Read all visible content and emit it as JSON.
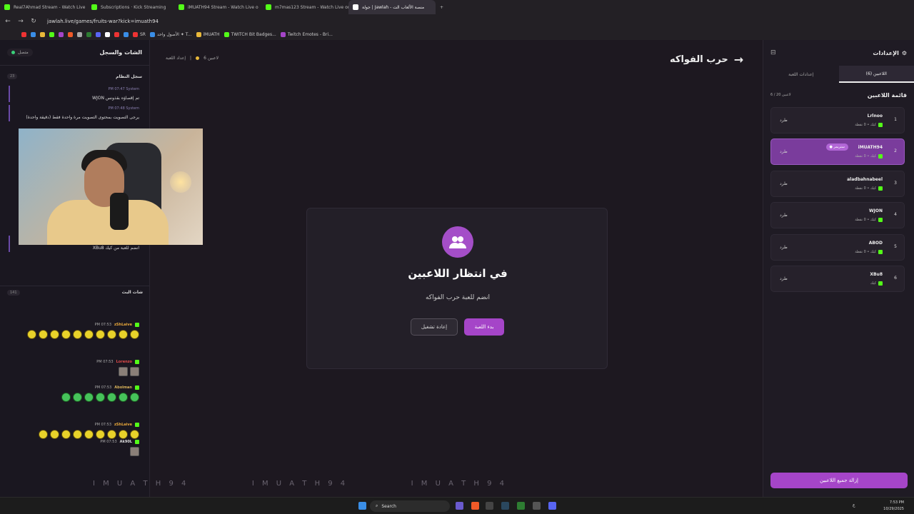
{
  "browser": {
    "tabs": [
      {
        "label": "Real7Ahmad Stream - Watch Live",
        "color": "#53fc18"
      },
      {
        "label": "Subscriptions · Kick Streaming",
        "color": "#53fc18"
      },
      {
        "label": "iMUATH94 Stream - Watch Live o",
        "color": "#53fc18"
      },
      {
        "label": "m7mas123 Stream - Watch Live on",
        "color": "#53fc18"
      },
      {
        "label": "جولة | Jawlah - منصة الألعاب الت",
        "color": "#ffffff",
        "active": true
      }
    ],
    "url": "jawlah.live/games/fruits-war?kick=imuath94",
    "bookmarks": [
      "SR",
      "الأصول واحد ✦ T...",
      "iMUATH",
      "TWITCH Bit Badges...",
      "Twitch Emotes - Bri..."
    ]
  },
  "left_panel": {
    "title": "الشات والسجل",
    "status": "متصل",
    "system_log": {
      "title": "سجل النظام",
      "count": "23",
      "messages": [
        {
          "time": "PM 07:47",
          "sender": "System",
          "text": "WJON تم إقصاؤه بقذونس"
        },
        {
          "time": "PM 07:48",
          "sender": "System",
          "text": "يرجى التصويت بمحتوى التصويت مرة واحدة فقط (دقيقة واحدة)"
        },
        {
          "time": "PM 07:52",
          "sender": "System",
          "text": "XBu8 انضم للعبة من كيك"
        }
      ]
    },
    "live_chat": {
      "title": "شات البث",
      "count": "141",
      "messages": [
        {
          "time": "PM 07:53",
          "user": "zShLaive",
          "user_color": "#e9a83a",
          "emotes": 10
        },
        {
          "time": "PM 07:53",
          "user": "Lorenzo",
          "user_color": "#e04a4a",
          "emotes": 2
        },
        {
          "time": "PM 07:53",
          "user": "Abolman",
          "user_color": "#d8b25a",
          "emotes": 7
        },
        {
          "time": "PM 07:53",
          "user": "zShLaive",
          "user_color": "#e9a83a",
          "emotes": 9
        },
        {
          "time": "PM 07:53",
          "user": "Ak90L",
          "user_color": "#dddddd",
          "emotes": 1
        }
      ]
    },
    "footer_handles": [
      "I M U A T H 9 4",
      "I M U A T H 9 4",
      "I M U A T H 9 4"
    ]
  },
  "game": {
    "title": "حرب الفواكه",
    "players_count_label": "6 لاعبين",
    "settings_label": "إعداد اللعبة",
    "modal": {
      "title": "في انتظار اللاعبين",
      "subtitle": "انضم للعبة حرب الفواكه",
      "start_button": "بدء اللعبة",
      "restart_button": "إعادة تشغيل"
    }
  },
  "right_panel": {
    "title": "الإعدادات",
    "tabs": [
      "اللاعبين (6)",
      "إعدادات اللعبة"
    ],
    "list_title": "قائمة اللاعبين",
    "list_count": "6 / 20 لاعبين",
    "kick_label": "طرد",
    "players": [
      {
        "rank": "1",
        "name": "Lrlnoo",
        "meta": "كيك • 0 نقطة"
      },
      {
        "rank": "2",
        "name": "iMUATH94",
        "meta": "كيك • 0 نقطة",
        "badge": "● ستريمر",
        "highlight": true
      },
      {
        "rank": "3",
        "name": "aladbahnabeel",
        "meta": "كيك • 0 نقطة"
      },
      {
        "rank": "4",
        "name": "WJON",
        "meta": "كيك • 0 نقطة"
      },
      {
        "rank": "5",
        "name": "ABOD",
        "meta": "كيك • 0 نقطة"
      },
      {
        "rank": "6",
        "name": "XBu8",
        "meta": "كيك"
      }
    ],
    "remove_all": "إزالة جميع اللاعبين"
  },
  "taskbar": {
    "search": "Search",
    "time": "7:53 PM",
    "date": "10/29/2025",
    "lang": "ع"
  },
  "colors": {
    "accent": "#a545c8",
    "kick_green": "#53fc18",
    "online": "#3ad07a"
  }
}
